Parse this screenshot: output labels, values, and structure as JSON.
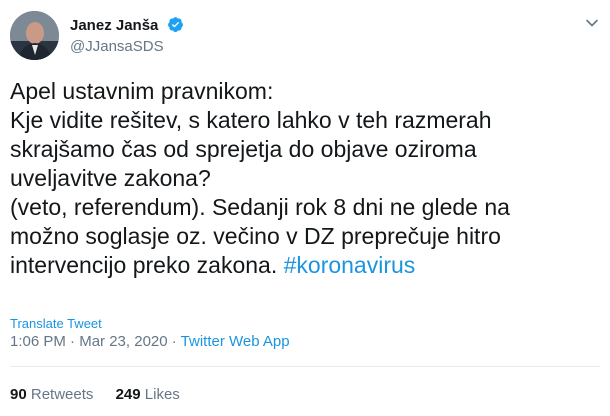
{
  "author": {
    "display_name": "Janez Janša",
    "handle": "@JJansaSDS",
    "verified": true
  },
  "tweet": {
    "lines": [
      "Apel ustavnim pravnikom:",
      "Kje vidite rešitev, s katero lahko v teh razmerah",
      "skrajšamo čas od sprejetja do objave oziroma",
      "uveljavitve zakona?",
      "(veto, referendum). Sedanji rok 8 dni ne glede na",
      "možno soglasje oz. večino v DZ preprečuje hitro",
      "intervencijo preko zakona. "
    ],
    "hashtag": "#koronavirus"
  },
  "translate_label": "Translate Tweet",
  "meta": {
    "time": "1:06 PM",
    "separator1": " · ",
    "date": "Mar 23, 2020",
    "separator2": " · ",
    "app": "Twitter Web App"
  },
  "stats": {
    "retweets_count": "90",
    "retweets_label": "Retweets",
    "likes_count": "249",
    "likes_label": "Likes"
  },
  "colors": {
    "link": "#1b95e0",
    "secondary_text": "#657786",
    "verified": "#1da1f2"
  }
}
